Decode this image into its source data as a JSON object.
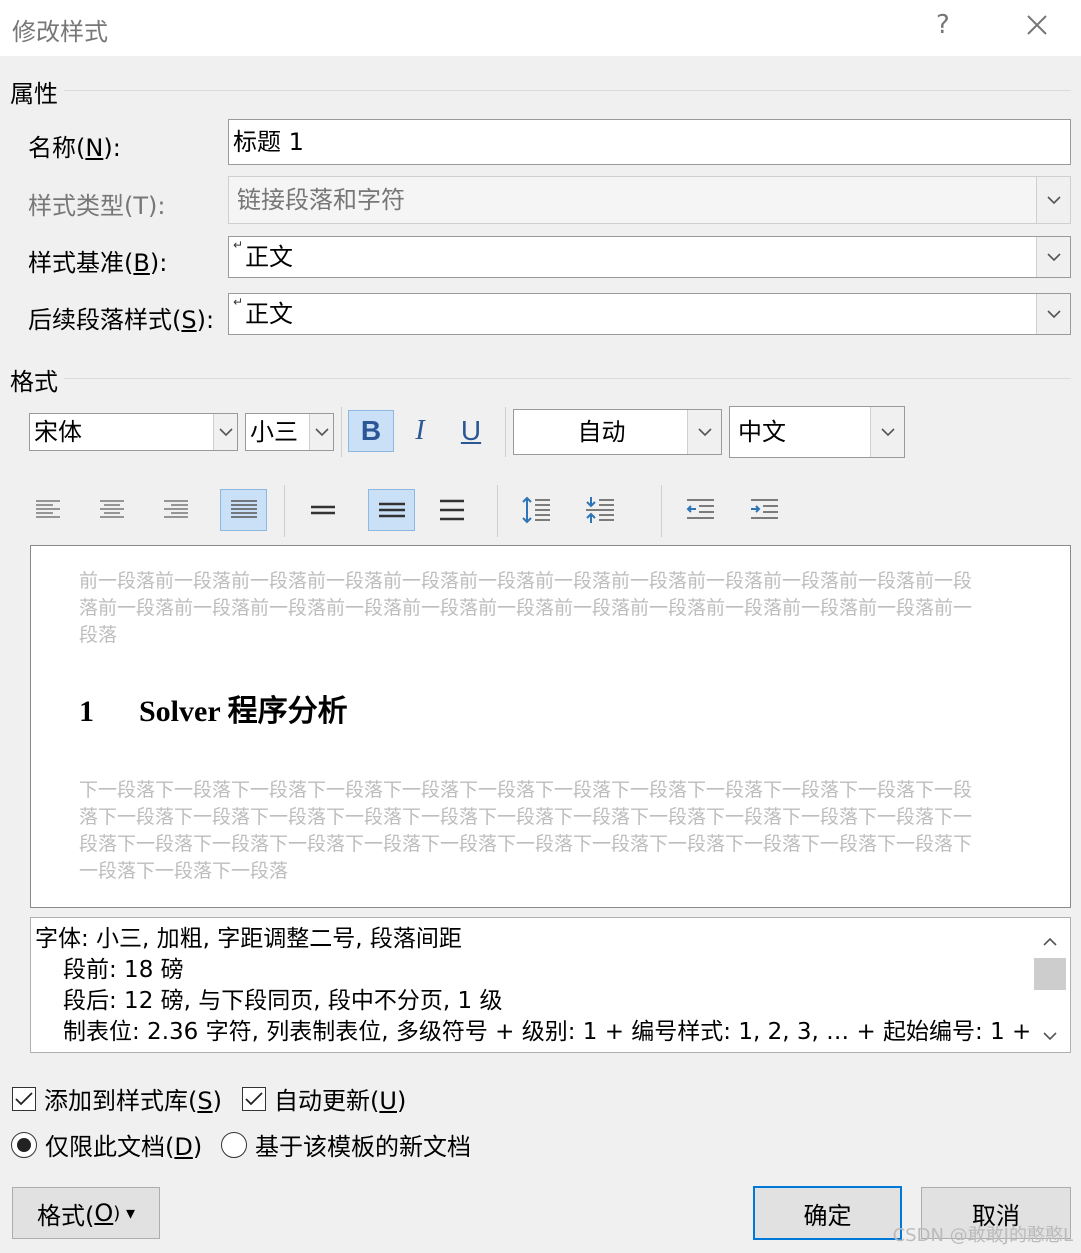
{
  "window": {
    "title": "修改样式",
    "help": "?",
    "close": "✕"
  },
  "properties": {
    "section_title": "属性",
    "name_label": "名称(",
    "name_key": "N",
    "name_suffix": "):",
    "name_value": "标题 1",
    "type_label": "样式类型(T):",
    "type_value": "链接段落和字符",
    "based_label": "样式基准(",
    "based_key": "B",
    "based_suffix": "):",
    "based_value": "正文",
    "next_label": "后续段落样式(",
    "next_key": "S",
    "next_suffix": "):",
    "next_value": "正文",
    "pilcrow": "↵"
  },
  "format": {
    "section_title": "格式",
    "font": "宋体",
    "size": "小三",
    "bold": "B",
    "italic": "I",
    "underline": "U",
    "color": "自动",
    "script": "中文"
  },
  "preview": {
    "before": "前一段落前一段落前一段落前一段落前一段落前一段落前一段落前一段落前一段落前一段落前一段落前一段落前一段落前一段落前一段落前一段落前一段落前一段落前一段落前一段落前一段落前一段落前一段落前一段落",
    "heading_number": "1",
    "heading_text": "Solver 程序分析",
    "after": "下一段落下一段落下一段落下一段落下一段落下一段落下一段落下一段落下一段落下一段落下一段落下一段落下一段落下一段落下一段落下一段落下一段落下一段落下一段落下一段落下一段落下一段落下一段落下一段落下一段落下一段落下一段落下一段落下一段落下一段落下一段落下一段落下一段落下一段落下一段落下一段落下一段落下一段落"
  },
  "description": {
    "line1": "字体: 小三, 加粗, 字距调整二号, 段落间距",
    "line2": "段前: 18 磅",
    "line3": "段后: 12 磅, 与下段同页, 段中不分页, 1 级",
    "line4": "制表位:  2.36 字符, 列表制表位, 多级符号 + 级别: 1 + 编号样式: 1, 2, 3, … + 起始编号: 1 +"
  },
  "options": {
    "add_to_gallery": "添加到样式库(",
    "add_key": "S",
    "auto_update": "自动更新(",
    "auto_key": "U",
    "close_paren": ")",
    "this_doc": "仅限此文档(",
    "this_doc_key": "D",
    "template": "基于该模板的新文档",
    "add_checked": true,
    "auto_checked": true,
    "selected_scope": "this_doc"
  },
  "buttons": {
    "format": "格式(",
    "format_key": "O",
    "format_suffix": ") ▾",
    "ok": "确定",
    "cancel": "取消"
  },
  "watermark": "CSDN @敢敢J的憨憨L"
}
